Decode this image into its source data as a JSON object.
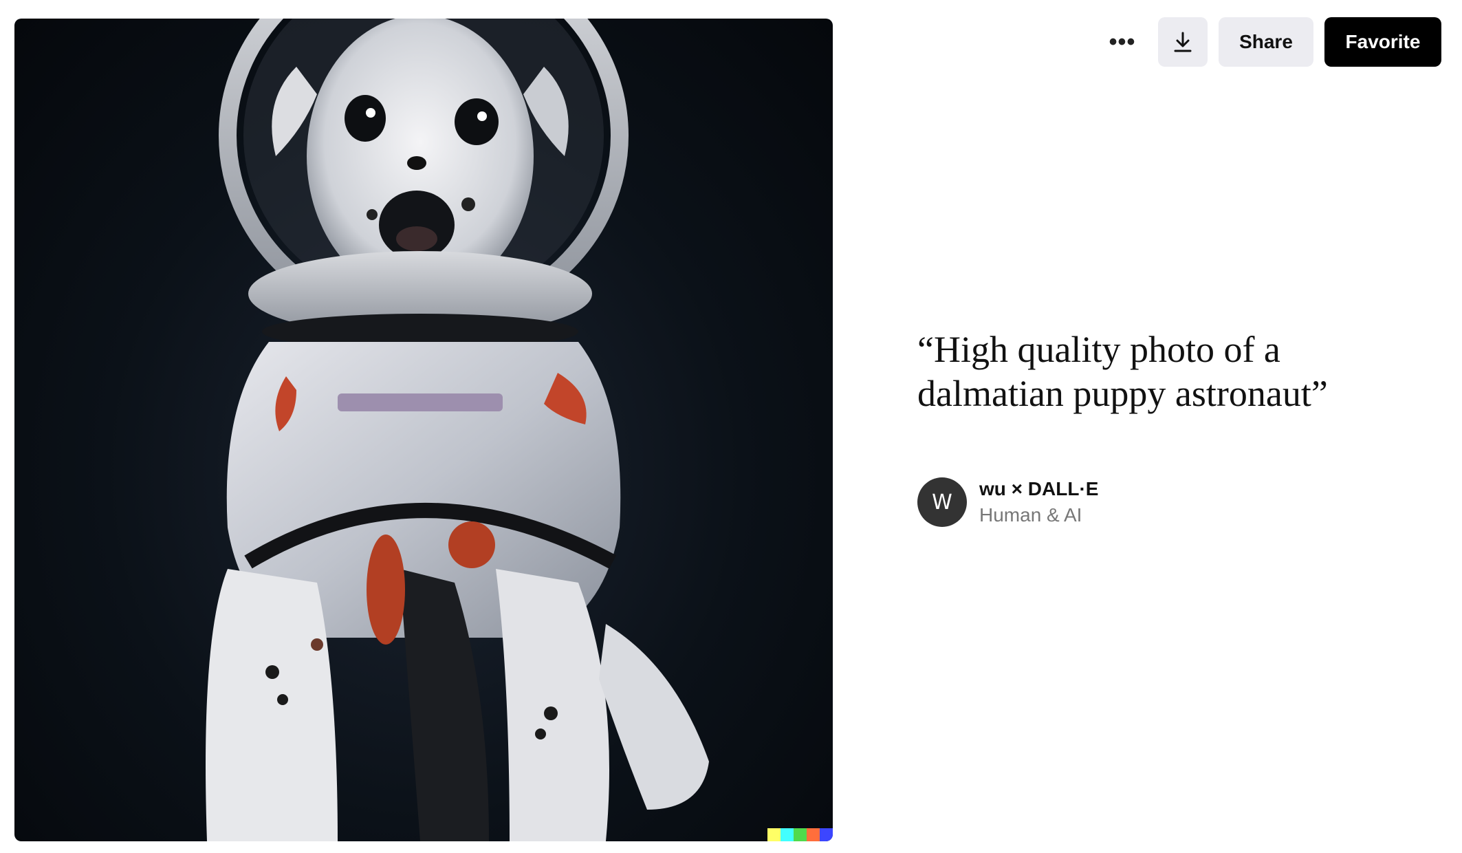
{
  "toolbar": {
    "more_label": "•••",
    "more_icon": "more-horizontal-icon",
    "download_icon": "download-icon",
    "share_label": "Share",
    "favorite_label": "Favorite"
  },
  "artwork": {
    "subject": "dalmatian puppy astronaut",
    "signature_colors": [
      "#ffff66",
      "#42ffff",
      "#51da4c",
      "#ff6e3c",
      "#3c46ff"
    ]
  },
  "caption": {
    "prompt": "“High quality photo of a dalmatian puppy astronaut”"
  },
  "author": {
    "avatar_initial": "W",
    "name": "wu × DALL·E",
    "role": "Human & AI"
  },
  "colors": {
    "favorite_bg": "#000000",
    "secondary_btn_bg": "#ececf1",
    "avatar_bg": "#333333"
  }
}
